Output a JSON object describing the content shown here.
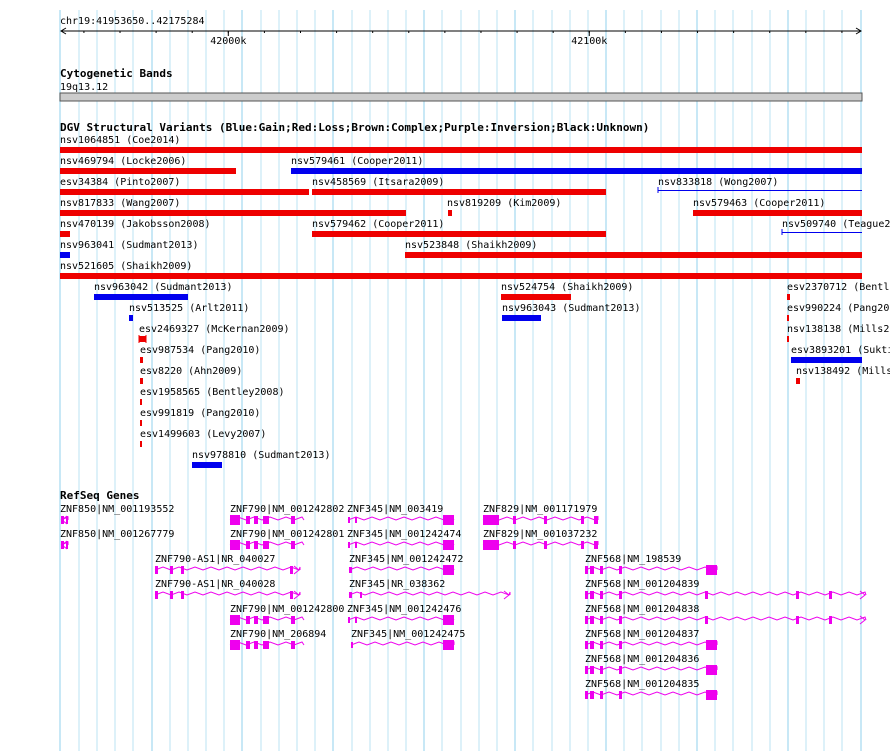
{
  "ruler": {
    "region": "chr19:41953650..42175284",
    "ticks": [
      {
        "label": "42000k",
        "pos": 42000000
      },
      {
        "label": "42100k",
        "pos": 42100000
      }
    ],
    "start": 41953650,
    "end": 42175284
  },
  "cytoband": {
    "title": "Cytogenetic Bands",
    "band": "19q13.12"
  },
  "dgv": {
    "title": "DGV Structural Variants (Blue:Gain;Red:Loss;Brown:Complex;Purple:Inversion;Black:Unknown)",
    "variants": [
      {
        "label": "nsv1064851 (Coe2014)",
        "type": "loss"
      },
      {
        "label": "nsv469794 (Locke2006)",
        "type": "loss"
      },
      {
        "label": "nsv579461 (Cooper2011)",
        "type": "gain"
      },
      {
        "label": "esv34384 (Pinto2007)",
        "type": "loss"
      },
      {
        "label": "nsv458569 (Itsara2009)",
        "type": "loss"
      },
      {
        "label": "nsv833818 (Wong2007)",
        "type": "gain"
      },
      {
        "label": "nsv817833 (Wang2007)",
        "type": "loss"
      },
      {
        "label": "nsv819209 (Kim2009)",
        "type": "loss"
      },
      {
        "label": "nsv579463 (Cooper2011)",
        "type": "loss"
      },
      {
        "label": "nsv470139 (Jakobsson2008)",
        "type": "loss"
      },
      {
        "label": "nsv579462 (Cooper2011)",
        "type": "loss"
      },
      {
        "label": "nsv509740 (Teague2",
        "type": "gain"
      },
      {
        "label": "nsv963041 (Sudmant2013)",
        "type": "gain"
      },
      {
        "label": "nsv523848 (Shaikh2009)",
        "type": "loss"
      },
      {
        "label": "nsv521605 (Shaikh2009)",
        "type": "loss"
      },
      {
        "label": "nsv963042 (Sudmant2013)",
        "type": "gain"
      },
      {
        "label": "nsv524754 (Shaikh2009)",
        "type": "loss"
      },
      {
        "label": "esv2370712 (Bentle",
        "type": "loss"
      },
      {
        "label": "nsv513525 (Arlt2011)",
        "type": "gain"
      },
      {
        "label": "nsv963043 (Sudmant2013)",
        "type": "gain"
      },
      {
        "label": "esv990224 (Pang20",
        "type": "loss"
      },
      {
        "label": "esv2469327 (McKernan2009)",
        "type": "loss"
      },
      {
        "label": "nsv138138 (Mills2",
        "type": "loss"
      },
      {
        "label": "esv987534 (Pang2010)",
        "type": "loss"
      },
      {
        "label": "esv3893201 (Sukti",
        "type": "gain"
      },
      {
        "label": "esv8220 (Ahn2009)",
        "type": "loss"
      },
      {
        "label": "nsv138492 (Mills",
        "type": "loss"
      },
      {
        "label": "esv1958565 (Bentley2008)",
        "type": "loss"
      },
      {
        "label": "esv991819 (Pang2010)",
        "type": "loss"
      },
      {
        "label": "esv1499603 (Levy2007)",
        "type": "loss"
      },
      {
        "label": "nsv978810 (Sudmant2013)",
        "type": "gain"
      }
    ]
  },
  "refseq": {
    "title": "RefSeq Genes",
    "genes": [
      {
        "label": "ZNF850|NM_001193552",
        "strand": "-"
      },
      {
        "label": "ZNF790|NM_001242802",
        "strand": "-"
      },
      {
        "label": "ZNF345|NM_003419",
        "strand": "+"
      },
      {
        "label": "ZNF829|NM_001171979",
        "strand": "-"
      },
      {
        "label": "ZNF850|NM_001267779",
        "strand": "-"
      },
      {
        "label": "ZNF790|NM_001242801",
        "strand": "-"
      },
      {
        "label": "ZNF345|NM_001242474",
        "strand": "+"
      },
      {
        "label": "ZNF829|NM_001037232",
        "strand": "-"
      },
      {
        "label": "ZNF790-AS1|NR_040027",
        "strand": "+"
      },
      {
        "label": "ZNF345|NM_001242472",
        "strand": "+"
      },
      {
        "label": "ZNF568|NM_198539",
        "strand": "+"
      },
      {
        "label": "ZNF790-AS1|NR_040028",
        "strand": "+"
      },
      {
        "label": "ZNF345|NR_038362",
        "strand": "+"
      },
      {
        "label": "ZNF568|NM_001204839",
        "strand": "+"
      },
      {
        "label": "ZNF790|NM_001242800",
        "strand": "-"
      },
      {
        "label": "ZNF345|NM_001242476",
        "strand": "+"
      },
      {
        "label": "ZNF568|NM_001204838",
        "strand": "+"
      },
      {
        "label": "ZNF790|NM_206894",
        "strand": "-"
      },
      {
        "label": "ZNF345|NM_001242475",
        "strand": "+"
      },
      {
        "label": "ZNF568|NM_001204837",
        "strand": "+"
      },
      {
        "label": "ZNF568|NM_001204836",
        "strand": "+"
      },
      {
        "label": "ZNF568|NM_001204835",
        "strand": "+"
      }
    ]
  },
  "colors": {
    "gain": "#0000ee",
    "loss": "#ee0000",
    "gene": "#ee00ee",
    "grid": "#aadcf0",
    "band": "#cccccc"
  }
}
